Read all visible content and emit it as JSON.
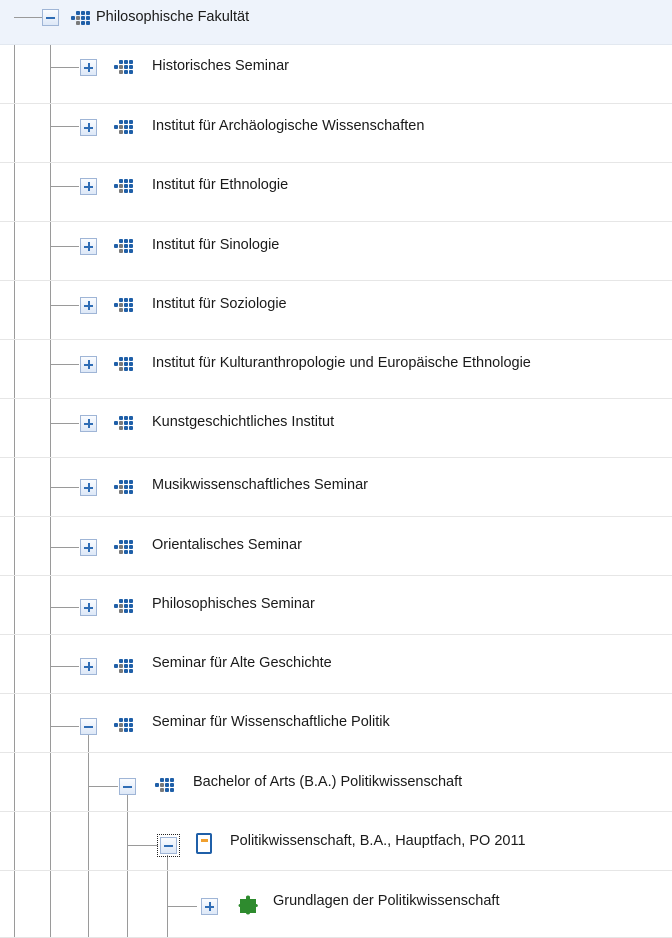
{
  "tree": {
    "nodes": [
      {
        "label": "Philosophische Fakultät",
        "icon": "organization-icon",
        "expanded": true
      },
      {
        "label": "Historisches Seminar",
        "icon": "organization-icon",
        "expanded": false
      },
      {
        "label": "Institut für Archäologische Wissenschaften",
        "icon": "organization-icon",
        "expanded": false
      },
      {
        "label": "Institut für Ethnologie",
        "icon": "organization-icon",
        "expanded": false
      },
      {
        "label": "Institut für Sinologie",
        "icon": "organization-icon",
        "expanded": false
      },
      {
        "label": "Institut für Soziologie",
        "icon": "organization-icon",
        "expanded": false
      },
      {
        "label": "Institut für Kulturanthropologie und Europäische Ethnologie",
        "icon": "organization-icon",
        "expanded": false
      },
      {
        "label": "Kunstgeschichtliches Institut",
        "icon": "organization-icon",
        "expanded": false
      },
      {
        "label": "Musikwissenschaftliches Seminar",
        "icon": "organization-icon",
        "expanded": false
      },
      {
        "label": "Orientalisches Seminar",
        "icon": "organization-icon",
        "expanded": false
      },
      {
        "label": "Philosophisches Seminar",
        "icon": "organization-icon",
        "expanded": false
      },
      {
        "label": "Seminar für Alte Geschichte",
        "icon": "organization-icon",
        "expanded": false
      },
      {
        "label": "Seminar für Wissenschaftliche Politik",
        "icon": "organization-icon",
        "expanded": true
      },
      {
        "label": "Bachelor of Arts (B.A.) Politikwissenschaft",
        "icon": "organization-icon",
        "expanded": true
      },
      {
        "label": "Politikwissenschaft, B.A., Hauptfach, PO 2011",
        "icon": "study-program-icon",
        "expanded": true
      },
      {
        "label": "Grundlagen der Politikwissenschaft",
        "icon": "module-puzzle-icon",
        "expanded": false
      }
    ]
  },
  "colors": {
    "accent_blue": "#1f5fa8",
    "program_orange": "#f0a030",
    "module_green": "#2e8b2e",
    "selected_row_bg": "#eef3fb"
  }
}
